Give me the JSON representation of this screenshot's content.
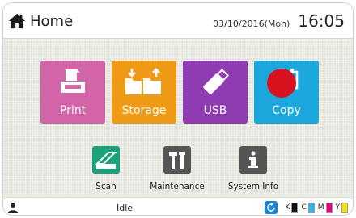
{
  "header": {
    "home_label": "Home",
    "date": "03/10/2016(Mon)",
    "time": "16:05"
  },
  "tiles": [
    {
      "label": "Print",
      "icon": "print-icon",
      "color": "#d264a8"
    },
    {
      "label": "Storage",
      "icon": "storage-icon",
      "color": "#ee9a17"
    },
    {
      "label": "USB",
      "icon": "usb-icon",
      "color": "#8f3cb3"
    },
    {
      "label": "Copy",
      "icon": "copy-icon",
      "color": "#1ba6dc"
    }
  ],
  "secondary": [
    {
      "label": "Scan",
      "icon": "scan-icon",
      "color": "#1aa27a"
    },
    {
      "label": "Maintenance",
      "icon": "maintenance-icon",
      "color": "#555555"
    },
    {
      "label": "System Info",
      "icon": "info-icon",
      "color": "#555555"
    }
  ],
  "status": {
    "text": "Idle",
    "inks": [
      {
        "label": "K",
        "color": "#111111"
      },
      {
        "label": "C",
        "color": "#2db3e8"
      },
      {
        "label": "M",
        "color": "#e4007f"
      },
      {
        "label": "Y",
        "color": "#f6e300"
      }
    ]
  }
}
